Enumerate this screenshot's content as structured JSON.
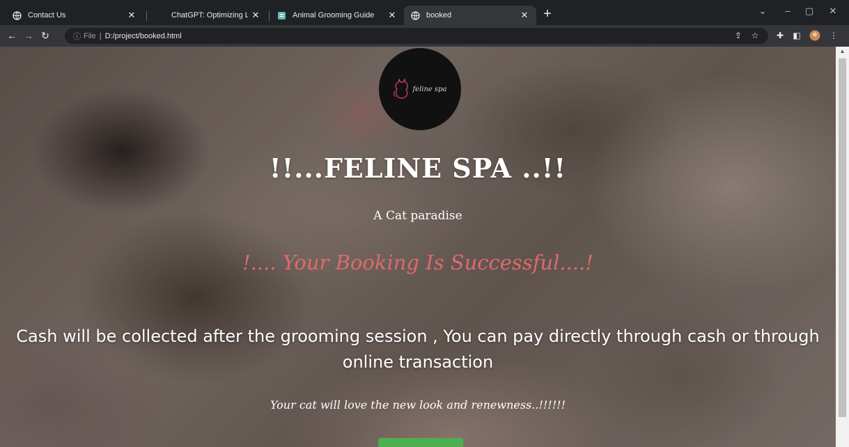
{
  "browser": {
    "tabs": [
      {
        "title": "Contact Us",
        "icon": "globe-icon",
        "active": false
      },
      {
        "title": "ChatGPT: Optimizing Language M",
        "icon": "chatgpt-icon",
        "active": false
      },
      {
        "title": "Animal Grooming Guide",
        "icon": "doc-icon",
        "active": false
      },
      {
        "title": "booked",
        "icon": "globe-icon",
        "active": true
      }
    ],
    "new_tab_label": "+",
    "address": {
      "scheme_label": "File",
      "path": "D:/project/booked.html"
    }
  },
  "page": {
    "logo_text": "feline spa",
    "title": "!!...FELINE SPA ..!!",
    "subtitle": "A Cat paradise",
    "success_message": "!.... Your Booking Is Successful....!",
    "payment_note": "Cash will be collected after the grooming session , You can pay directly through cash or through online transaction",
    "closing_note": "Your cat will love the new look and renewness..!!!!!!"
  },
  "colors": {
    "success_text": "#e06a6a",
    "button_bg": "#4caf50",
    "logo_bg": "#111111",
    "logo_accent": "#c0435c"
  }
}
